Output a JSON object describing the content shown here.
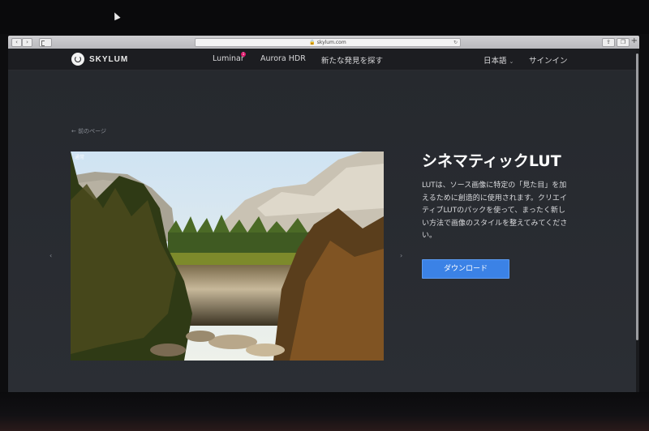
{
  "browser": {
    "address": "🔒 skylum.com",
    "back_label": "‹",
    "forward_label": "›",
    "reload_icon": "reload-icon",
    "share_label": "⇪",
    "tabs_label": "❐",
    "new_tab_label": "+"
  },
  "header": {
    "brand": "SKYLUM",
    "nav": {
      "luminar": "Luminar",
      "luminar_badge": "1",
      "aurora": "Aurora HDR",
      "discover": "新たな発見を探す"
    },
    "language": "日本語",
    "language_chevron": "⌄",
    "signin": "サインイン"
  },
  "main": {
    "back_link": "← 前のページ",
    "prev_arrow": "‹",
    "next_arrow": "›",
    "photo_label": "通常",
    "title": "シネマティックLUT",
    "description": "LUTは、ソース画像に特定の「見た目」を加えるために創造的に使用されます。クリエイティブLUTのパックを使って、まったく新しい方法で画像のスタイルを整えてみてください。",
    "download_label": "ダウンロード"
  },
  "colors": {
    "accent": "#3b82e6",
    "badge": "#e0186c",
    "page_bg": "#2b2e34",
    "header_bg": "#1c1d21"
  }
}
